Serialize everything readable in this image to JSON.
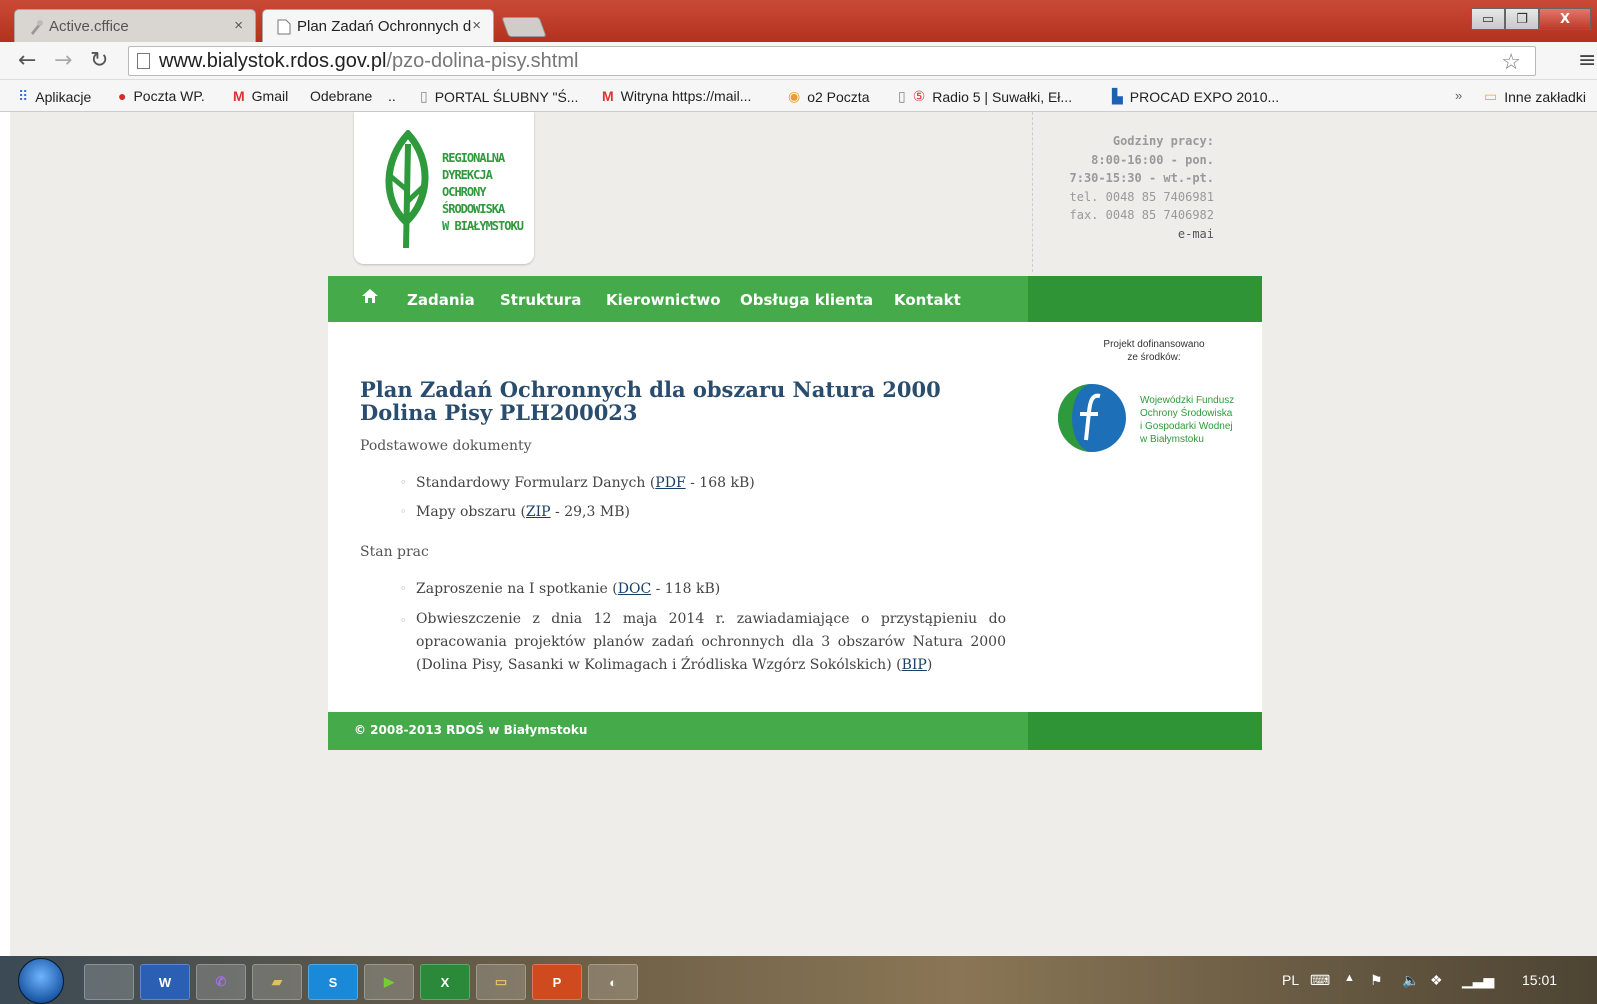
{
  "browser": {
    "tabs": [
      {
        "title": "Active.cffice",
        "close": "×"
      },
      {
        "title": "Plan Zadań Ochronnych d",
        "close": "×"
      }
    ],
    "window_controls": {
      "minimize": "▭",
      "restore": "❐",
      "close": "X"
    },
    "url_host": "www.bialystok.rdos.gov.pl",
    "url_path": "/pzo-dolina-pisy.shtml",
    "bookmarks": [
      "Aplikacje",
      "Poczta WP.",
      "Gmail",
      "Odebrane",
      "..",
      "PORTAL ŚLUBNY \"Ś...",
      "Witryna https://mail...",
      "o2 Poczta",
      "Radio 5 | Suwałki, Eł...",
      "PROCAD EXPO 2010..."
    ],
    "bookmarks_overflow": "»",
    "other_bookmarks": "Inne zakładki"
  },
  "logo": {
    "lines": [
      "REGIONALNA",
      "DYREKCJA",
      "OCHRONY",
      "ŚRODOWISKA",
      "W BIAŁYMSTOKU"
    ]
  },
  "contact": {
    "hours_label": "Godziny pracy:",
    "hours_mon": "8:00-16:00 - pon.",
    "hours_tue_fri": "7:30-15:30 - wt.-pt.",
    "tel": "tel. 0048 85 7406981",
    "fax": "fax. 0048 85 7406982",
    "email": "e-mai"
  },
  "nav": {
    "items": [
      "Zadania",
      "Struktura",
      "Kierownictwo",
      "Obsługa klienta",
      "Kontakt"
    ]
  },
  "main": {
    "title": "Plan Zadań Ochronnych dla obszaru Natura 2000 Dolina Pisy PLH200023",
    "section1": "Podstawowe dokumenty",
    "doc1_pre": "Standardowy Formularz Danych (",
    "doc1_link": "PDF",
    "doc1_post": " - 168 kB)",
    "doc2_pre": "Mapy obszaru (",
    "doc2_link": "ZIP",
    "doc2_post": " - 29,3 MB)",
    "section2": "Stan prac",
    "doc3_pre": "Zaproszenie na I spotkanie (",
    "doc3_link": "DOC",
    "doc3_post": " - 118 kB)",
    "doc4_pre": "Obwieszczenie z dnia 12 maja 2014 r. zawiadamiające o przystąpieniu do opracowania projektów planów zadań ochronnych dla 3 obszarów Natura 2000 (Dolina Pisy, Sasanki w Kolimagach i Źródliska Wzgórz Sokólskich) (",
    "doc4_link": "BIP",
    "doc4_post": ")"
  },
  "sponsor": {
    "caption_1": "Projekt dofinansowano",
    "caption_2": "ze środków:",
    "lines": [
      "Wojewódzki Fundusz",
      "Ochrony Środowiska",
      "i Gospodarki Wodnej",
      "w Białymstoku"
    ]
  },
  "footer": {
    "copyright": "© 2008-2013 RDOŚ w Białymstoku"
  },
  "taskbar": {
    "apps": [
      "",
      "W",
      "",
      "",
      "S",
      "",
      "X",
      "",
      "P",
      ""
    ],
    "lang": "PL",
    "time": "15:01"
  },
  "colors": {
    "brand_green": "#44aa4a",
    "brand_green_dark": "#2f9436",
    "title_blue": "#2a4d6e",
    "chrome_red": "#b3311f"
  }
}
